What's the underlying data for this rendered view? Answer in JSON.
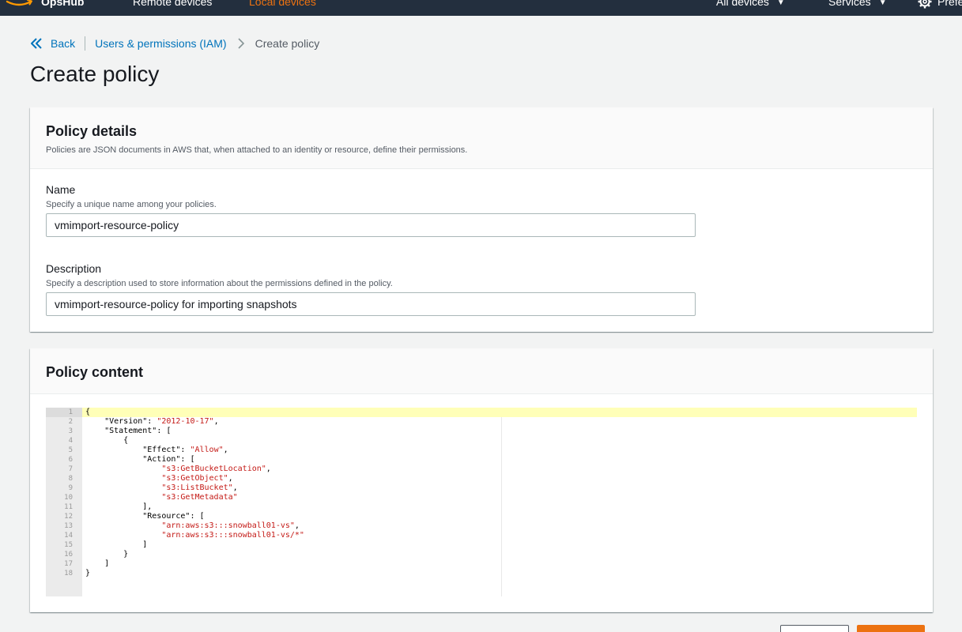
{
  "topbar": {
    "brand": "OpsHub",
    "nav": [
      {
        "label": "Remote devices",
        "active": false
      },
      {
        "label": "Local devices",
        "active": true
      }
    ],
    "devices_label": "All devices",
    "services_label": "Services",
    "preferences_label": "Preferences",
    "active_color": "#ec7211",
    "background_color": "#232f3e"
  },
  "breadcrumb": {
    "back_label": "Back",
    "parent_label": "Users & permissions (IAM)",
    "current_label": "Create policy"
  },
  "page_title": "Create policy",
  "details": {
    "title": "Policy details",
    "description": "Policies are JSON documents in AWS that, when attached to an identity or resource, define their permissions.",
    "name_label": "Name",
    "name_hint": "Specify a unique name among your policies.",
    "name_value": "vmimport-resource-policy",
    "desc_label": "Description",
    "desc_hint": "Specify a description used to store information about the permissions defined in the policy.",
    "desc_value": "vmimport-resource-policy for importing snapshots"
  },
  "content": {
    "title": "Policy content",
    "code_lines": [
      "{",
      "    \"Version\": \"2012-10-17\",",
      "    \"Statement\": [",
      "        {",
      "            \"Effect\": \"Allow\",",
      "            \"Action\": [",
      "                \"s3:GetBucketLocation\",",
      "                \"s3:GetObject\",",
      "                \"s3:ListBucket\",",
      "                \"s3:GetMetadata\"",
      "            ],",
      "            \"Resource\": [",
      "                \"arn:aws:s3:::snowball01-vs\",",
      "                \"arn:aws:s3:::snowball01-vs/*\"",
      "            ]",
      "        }",
      "    ]",
      "}"
    ]
  },
  "buttons": {
    "cancel_label": "",
    "create_label": ""
  }
}
